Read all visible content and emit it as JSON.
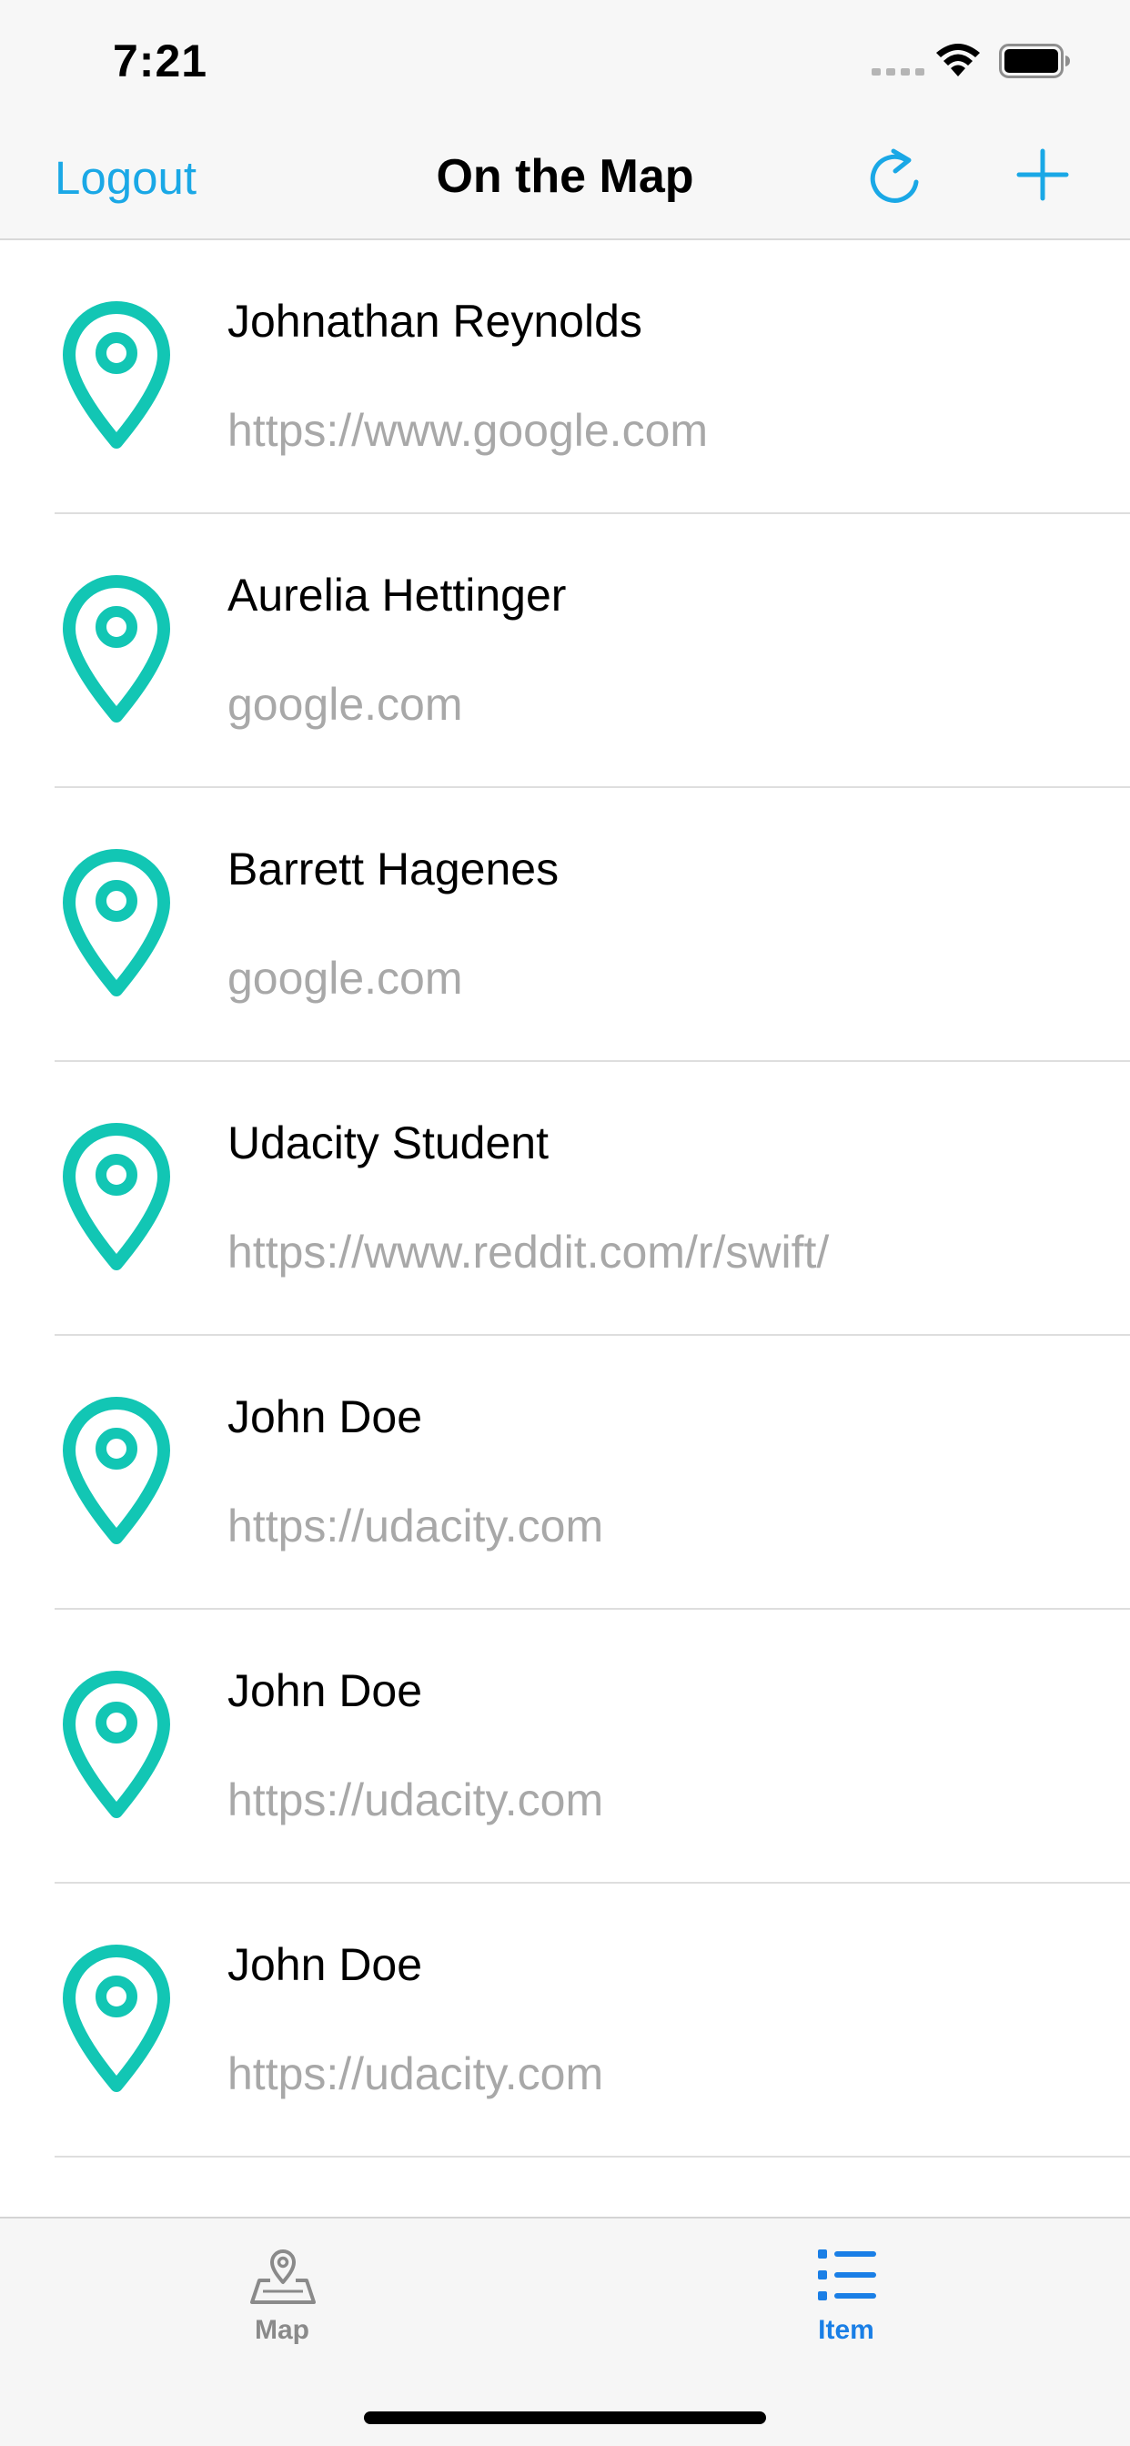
{
  "status_bar": {
    "time": "7:21"
  },
  "nav": {
    "logout_label": "Logout",
    "title": "On the Map",
    "refresh_icon": "refresh-icon",
    "add_icon": "plus-icon"
  },
  "colors": {
    "accent": "#1aa8e6",
    "pin": "#12c6b4",
    "subtitle": "#a8a8a8",
    "tab_active": "#1a7fe6",
    "tab_inactive": "#8a8a8a"
  },
  "list": {
    "items": [
      {
        "name": "Johnathan Reynolds",
        "url": "https://www.google.com",
        "icon": "location-pin-icon"
      },
      {
        "name": "Aurelia Hettinger",
        "url": "google.com",
        "icon": "location-pin-icon"
      },
      {
        "name": "Barrett Hagenes",
        "url": "google.com",
        "icon": "location-pin-icon"
      },
      {
        "name": "Udacity Student",
        "url": "https://www.reddit.com/r/swift/",
        "icon": "location-pin-icon"
      },
      {
        "name": "John Doe",
        "url": "https://udacity.com",
        "icon": "location-pin-icon"
      },
      {
        "name": "John Doe",
        "url": "https://udacity.com",
        "icon": "location-pin-icon"
      },
      {
        "name": "John Doe",
        "url": "https://udacity.com",
        "icon": "location-pin-icon"
      }
    ]
  },
  "tabs": [
    {
      "label": "Map",
      "icon": "map-icon",
      "selected": false
    },
    {
      "label": "Item",
      "icon": "list-icon",
      "selected": true
    }
  ]
}
